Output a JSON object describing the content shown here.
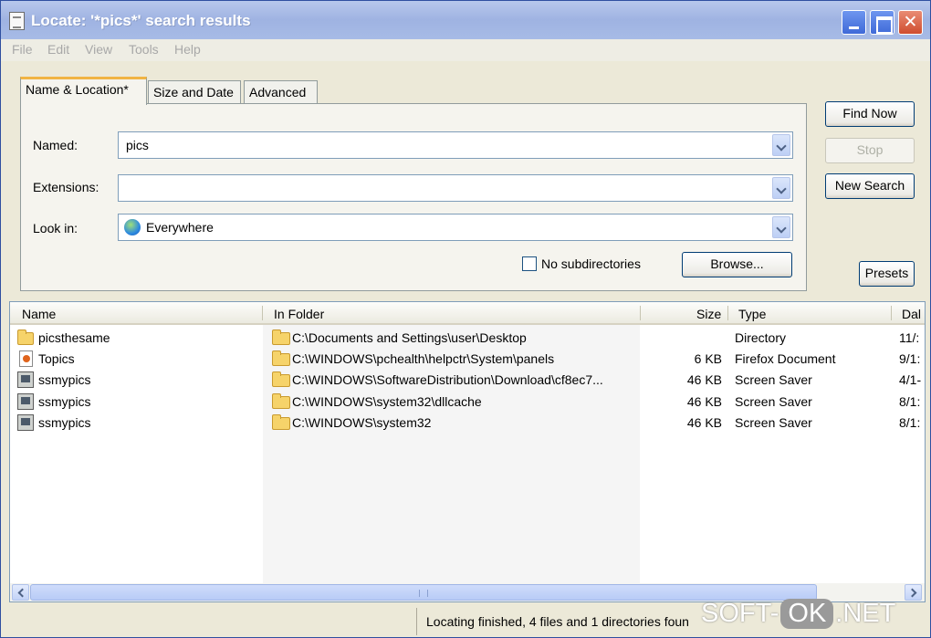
{
  "window": {
    "title": "Locate: '*pics*' search results",
    "minimize_label": "",
    "close_label": "✕"
  },
  "menu": [
    "File",
    "Edit",
    "View",
    "Tools",
    "Help"
  ],
  "tabs": [
    "Name & Location*",
    "Size and Date",
    "Advanced"
  ],
  "form": {
    "named_label": "Named:",
    "named_value": "pics",
    "extensions_label": "Extensions:",
    "extensions_value": "",
    "lookin_label": "Look in:",
    "lookin_value": "Everywhere",
    "nosubdirs_label": "No subdirectories",
    "nosubdirs_checked": false,
    "browse_label": "Browse..."
  },
  "actions": {
    "find_now": "Find Now",
    "stop": "Stop",
    "new_search": "New Search",
    "presets": "Presets"
  },
  "list": {
    "columns": [
      "Name",
      "In Folder",
      "Size",
      "Type",
      "Dal"
    ],
    "rows": [
      {
        "name": "picsthesame",
        "icon": "folder-icon",
        "folder": "C:\\Documents and Settings\\user\\Desktop",
        "size": "",
        "type": "Directory",
        "date": "11/:"
      },
      {
        "name": "Topics",
        "icon": "firefox-document-icon",
        "folder": "C:\\WINDOWS\\pchealth\\helpctr\\System\\panels",
        "size": "6 KB",
        "type": "Firefox Document",
        "date": "9/1:"
      },
      {
        "name": "ssmypics",
        "icon": "screen-saver-icon",
        "folder": "C:\\WINDOWS\\SoftwareDistribution\\Download\\cf8ec7...",
        "size": "46 KB",
        "type": "Screen Saver",
        "date": "4/1-"
      },
      {
        "name": "ssmypics",
        "icon": "screen-saver-icon",
        "folder": "C:\\WINDOWS\\system32\\dllcache",
        "size": "46 KB",
        "type": "Screen Saver",
        "date": "8/1:"
      },
      {
        "name": "ssmypics",
        "icon": "screen-saver-icon",
        "folder": "C:\\WINDOWS\\system32",
        "size": "46 KB",
        "type": "Screen Saver",
        "date": "8/1:"
      }
    ]
  },
  "status": {
    "text": "Locating finished, 4 files and 1 directories foun"
  },
  "watermark": {
    "left": "SOFT-",
    "middle": "OK",
    "right": ".NET"
  }
}
